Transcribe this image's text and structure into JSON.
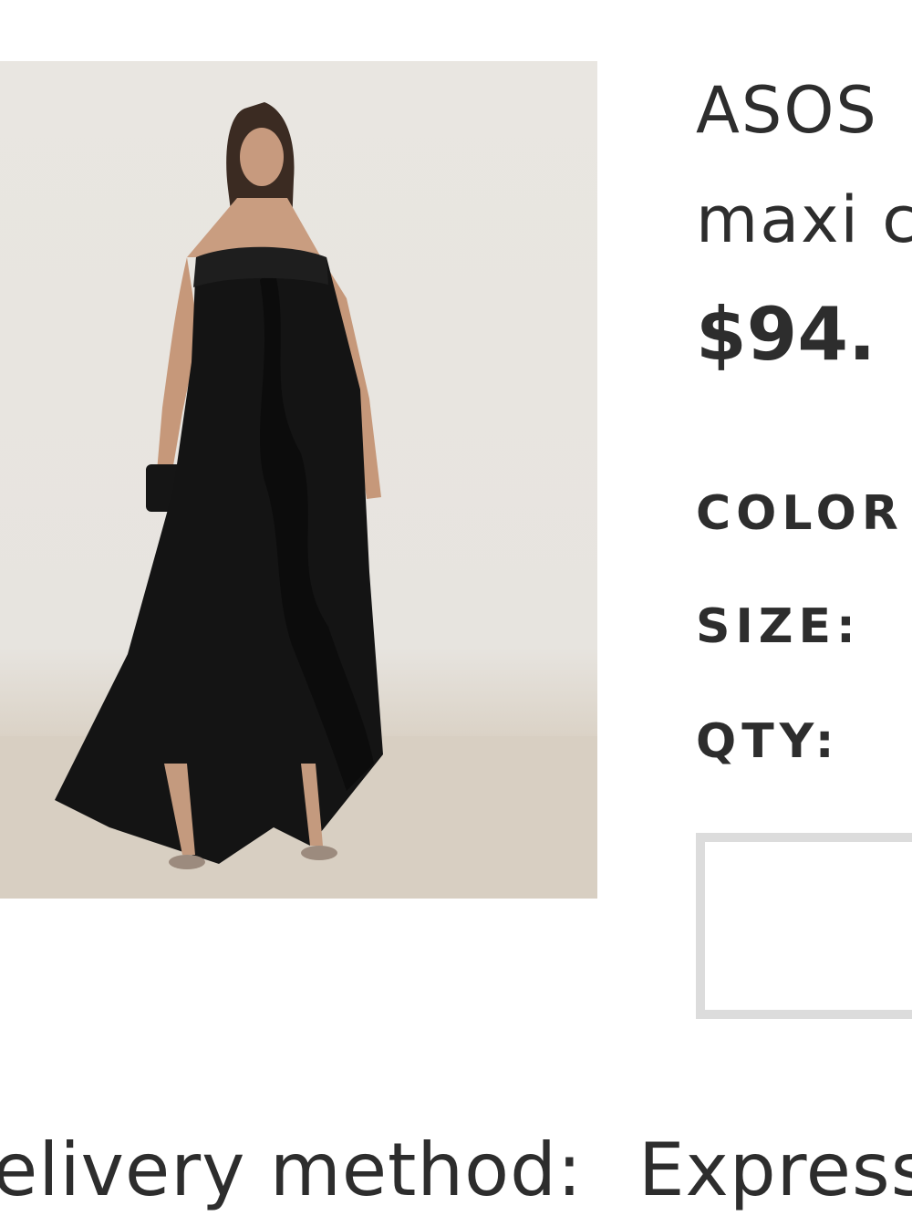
{
  "product": {
    "title_line1": "ASOS",
    "title_line2": "maxi c",
    "price": "$94.",
    "image_alt": "black-ruffle-maxi-dress-photo"
  },
  "options": {
    "color_label": "COLOR",
    "size_label": "SIZE:",
    "qty_label": "QTY:"
  },
  "delivery": {
    "label": "elivery method:",
    "value": "Express"
  },
  "colors": {
    "text": "#2d2d2d",
    "box_border": "#dcdcdc",
    "image_bg": "#e8e5e0"
  }
}
